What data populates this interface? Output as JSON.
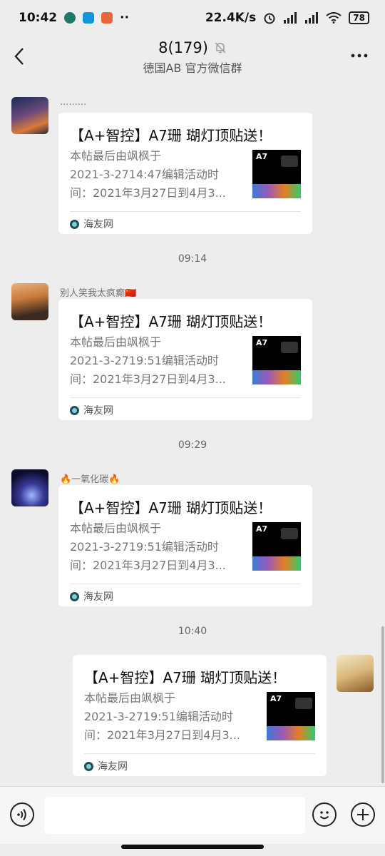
{
  "status_bar": {
    "time": "10:42",
    "net_speed": "22.4K/s",
    "battery": "78",
    "app_icon_colors": [
      "#1f7a6a",
      "#1296db",
      "#e8663a"
    ]
  },
  "header": {
    "title": "8(179)",
    "subtitle": "德国AB  官方微信群"
  },
  "messages": [
    {
      "sender": "·········",
      "title": "【A+智控】A7珊 瑚灯顶贴送！",
      "desc_lines": [
        "本帖最后由飒枫于",
        "2021-3-2714:47编辑活动时",
        "间：2021年3月27日到4月3..."
      ],
      "source": "海友网",
      "thumb_label": "A7"
    },
    {
      "time": "09:14",
      "sender": "别人笑我太疯癫🇨🇳",
      "title": "【A+智控】A7珊 瑚灯顶贴送！",
      "desc_lines": [
        "本帖最后由飒枫于",
        "2021-3-2719:51编辑活动时",
        "间：2021年3月27日到4月3..."
      ],
      "source": "海友网",
      "thumb_label": "A7"
    },
    {
      "time": "09:29",
      "sender": "🔥一氧化碳🔥",
      "title": "【A+智控】A7珊 瑚灯顶贴送！",
      "desc_lines": [
        "本帖最后由飒枫于",
        "2021-3-2719:51编辑活动时",
        "间：2021年3月27日到4月3..."
      ],
      "source": "海友网",
      "thumb_label": "A7"
    },
    {
      "time": "10:40",
      "title": "【A+智控】A7珊 瑚灯顶贴送！",
      "desc_lines": [
        "本帖最后由飒枫于",
        "2021-3-2719:51编辑活动时",
        "间：2021年3月27日到4月3..."
      ],
      "source": "海友网",
      "thumb_label": "A7"
    }
  ]
}
